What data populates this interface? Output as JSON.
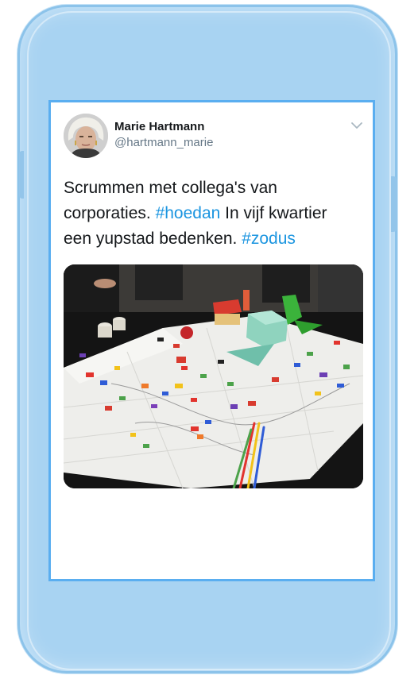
{
  "tweet": {
    "author_name": "Marie Hartmann",
    "author_handle": "@hartmann_marie",
    "line1": "Scrummen met collega's van",
    "line2_a": "corporaties. ",
    "line2_tag": "#hoedan",
    "line2_b": " In vijf kwartier",
    "line3_a": "een yupstad bedenken. ",
    "line3_tag": "#zodus"
  },
  "colors": {
    "phone_body": "#a8d3f2",
    "screen_border": "#5aaef0",
    "hashtag": "#1b95e0",
    "name": "#14171a",
    "handle": "#657786"
  },
  "icons": {
    "menu": "chevron-down-icon",
    "avatar": "avatar"
  }
}
